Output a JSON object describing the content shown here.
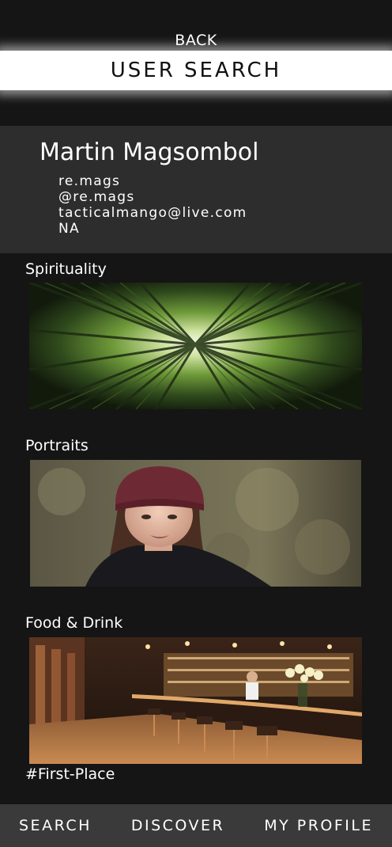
{
  "header": {
    "back_label": "BACK",
    "title": "USER SEARCH"
  },
  "profile": {
    "name": "Martin Magsombol",
    "username": "re.mags",
    "handle": "@re.mags",
    "email": "tacticalmango@live.com",
    "location": "NA"
  },
  "galleries": [
    {
      "label": "Spirituality",
      "image": "bamboo-forest-photo"
    },
    {
      "label": "Portraits",
      "image": "woman-in-beanie-portrait-photo"
    },
    {
      "label": "Food & Drink",
      "image": "restaurant-bar-interior-photo"
    }
  ],
  "tag": "#First-Place",
  "nav": {
    "search": "SEARCH",
    "discover": "DISCOVER",
    "my_profile": "MY PROFILE"
  },
  "colors": {
    "background": "#151515",
    "card": "#2d2d2d",
    "nav": "#3a3a3a",
    "title_bar": "#ffffff"
  }
}
